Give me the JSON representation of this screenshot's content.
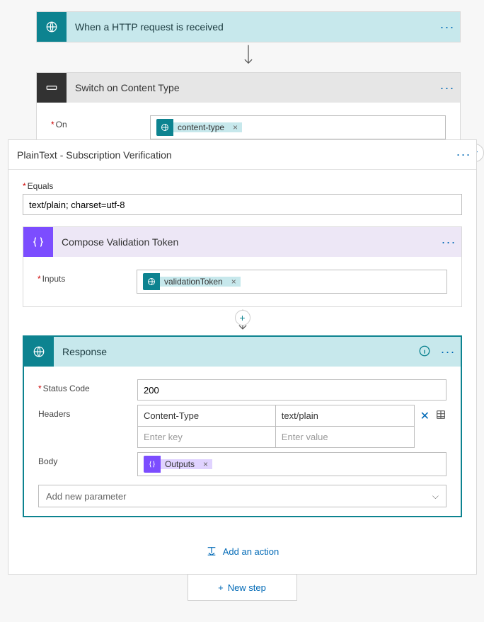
{
  "trigger": {
    "title": "When a HTTP request is received"
  },
  "switch": {
    "title": "Switch on Content Type",
    "onLabel": "On",
    "token": {
      "label": "content-type"
    }
  },
  "case1": {
    "title": "PlainText - Subscription Verification",
    "equalsLabel": "Equals",
    "equalsValue": "text/plain; charset=utf-8",
    "compose": {
      "title": "Compose Validation Token",
      "inputsLabel": "Inputs",
      "token": {
        "label": "validationToken"
      }
    },
    "response": {
      "title": "Response",
      "statusLabel": "Status Code",
      "statusValue": "200",
      "headersLabel": "Headers",
      "headers": [
        {
          "key": "Content-Type",
          "value": "text/plain"
        }
      ],
      "headerKeyPlaceholder": "Enter key",
      "headerValPlaceholder": "Enter value",
      "bodyLabel": "Body",
      "bodyToken": {
        "label": "Outputs"
      },
      "addParamPlaceholder": "Add new parameter"
    },
    "addAction": "Add an action"
  },
  "newStep": "New step"
}
